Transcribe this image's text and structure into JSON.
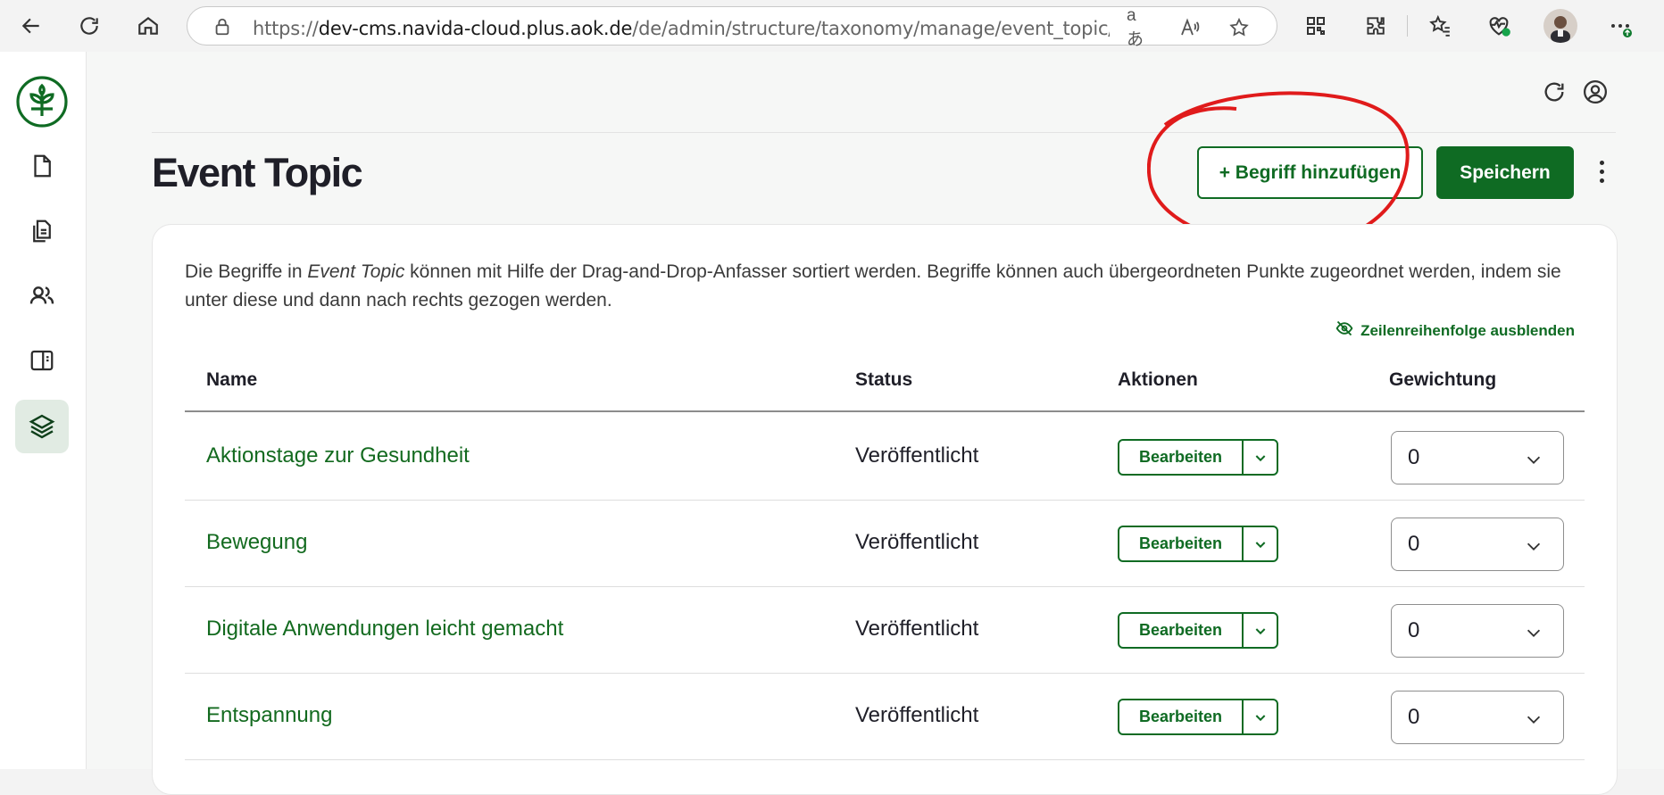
{
  "browser": {
    "url_prefix": "https://",
    "url_domain": "dev-cms.navida-cloud.plus.aok.de",
    "url_path": "/de/admin/structure/taxonomy/manage/event_topic/overvi...",
    "read_aloud_label": "aあ"
  },
  "page": {
    "title": "Event Topic",
    "add_button": "+ Begriff hinzufügen",
    "save_button": "Speichern"
  },
  "description": {
    "part1": "Die Begriffe in ",
    "vocab": "Event Topic",
    "part2": " können mit Hilfe der Drag-and-Drop-Anfasser sortiert werden. Begriffe können auch übergeordneten Punkte zugeordnet werden, indem sie unter diese und dann nach rechts gezogen werden."
  },
  "toggle_row_weights": "Zeilenreihenfolge ausblenden",
  "table": {
    "headers": {
      "name": "Name",
      "status": "Status",
      "actions": "Aktionen",
      "weight": "Gewichtung"
    },
    "rows": [
      {
        "name": "Aktionstage zur Gesundheit",
        "status": "Veröffentlicht",
        "action": "Bearbeiten",
        "weight": "0"
      },
      {
        "name": "Bewegung",
        "status": "Veröffentlicht",
        "action": "Bearbeiten",
        "weight": "0"
      },
      {
        "name": "Digitale Anwendungen leicht gemacht",
        "status": "Veröffentlicht",
        "action": "Bearbeiten",
        "weight": "0"
      },
      {
        "name": "Entspannung",
        "status": "Veröffentlicht",
        "action": "Bearbeiten",
        "weight": "0"
      }
    ]
  },
  "colors": {
    "brand_green": "#0f6b23",
    "annotation_red": "#e01b1b"
  },
  "icons": [
    "back-icon",
    "reload-icon",
    "home-icon",
    "lock-icon",
    "translate-icon",
    "read-aloud-icon",
    "favorite-star-icon",
    "qr-icon",
    "extensions-icon",
    "favorites-icon",
    "health-icon",
    "profile-avatar",
    "more-icon",
    "aok-logo",
    "document-icon",
    "documents-icon",
    "users-icon",
    "layout-icon",
    "layers-icon",
    "refresh-icon",
    "account-icon",
    "eye-off-icon",
    "chevron-down-icon"
  ]
}
